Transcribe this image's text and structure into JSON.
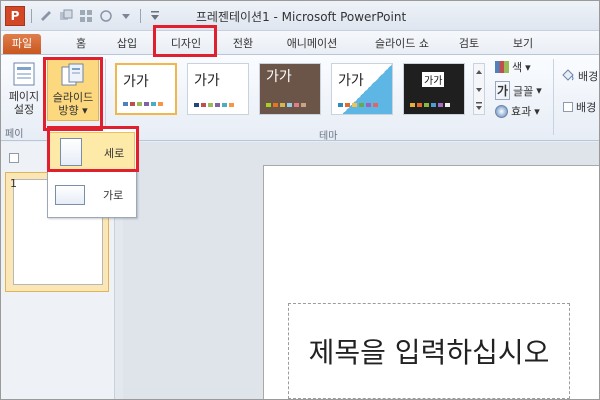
{
  "window": {
    "title": "프레젠테이션1 - Microsoft PowerPoint",
    "app_icon": "P"
  },
  "tabs": {
    "file": "파일",
    "home": "홈",
    "insert": "삽입",
    "design": "디자인",
    "transitions": "전환",
    "animations": "애니메이션",
    "slideshow": "슬라이드 쇼",
    "review": "검토",
    "view": "보기"
  },
  "ribbon": {
    "page_setup": "페이지 설정",
    "page_setup_line1": "페이지",
    "page_setup_line2": "설정",
    "orientation_line1": "슬라이드",
    "orientation_line2": "방향",
    "group_page": "페이",
    "group_theme": "테마",
    "theme_sample": "가가",
    "colors": "색",
    "fonts": "글꼴",
    "effects": "효과",
    "background_style": "배경",
    "hide_bg": "배경"
  },
  "dropdown": {
    "portrait": "세로",
    "landscape": "가로"
  },
  "thumbnail": {
    "number": "1"
  },
  "slide": {
    "title_placeholder": "제목을 입력하십시오"
  },
  "colors": {
    "highlight": "#e0202e",
    "file_tab": "#c9561f",
    "accent": "#2b579a"
  }
}
